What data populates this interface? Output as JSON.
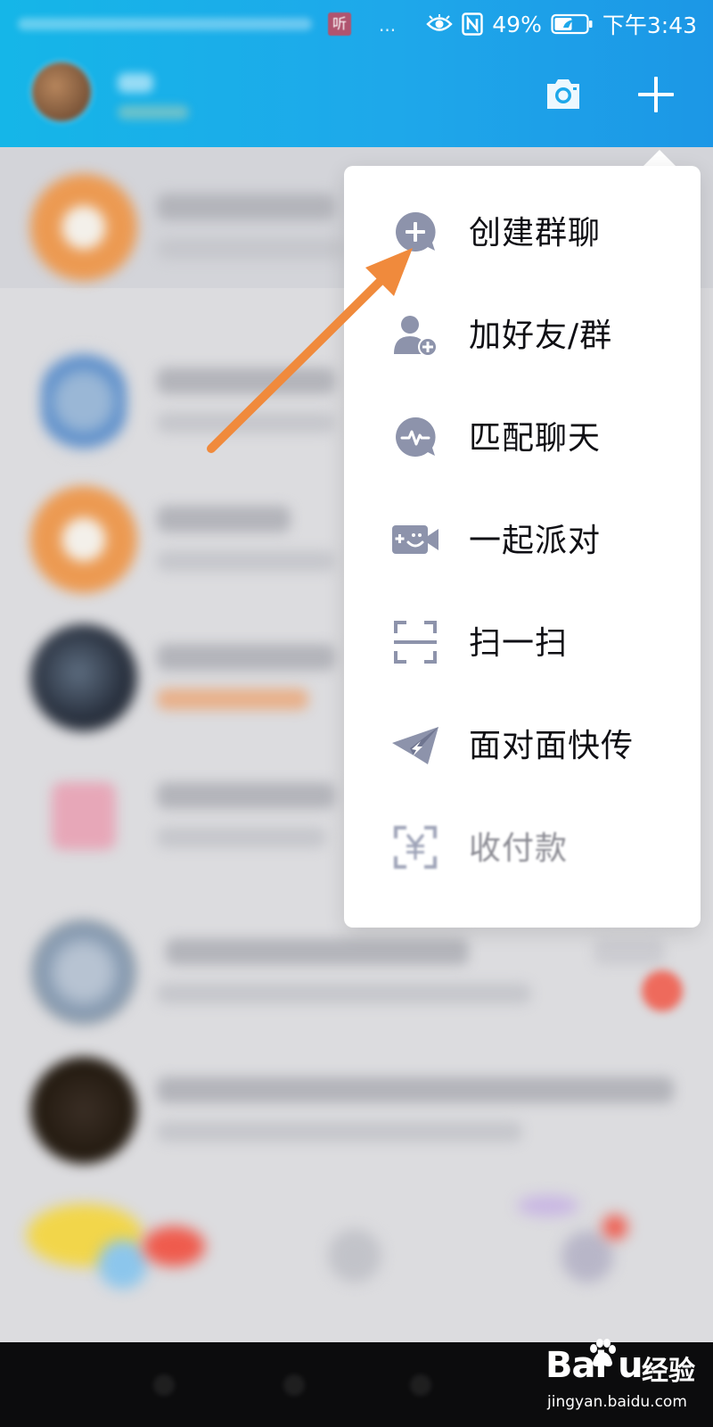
{
  "status_bar": {
    "ting_badge": "听",
    "more_dots": "···",
    "battery": "49%",
    "time": "下午3:43"
  },
  "colors": {
    "header_blue": "#1ea8ea",
    "menu_icon": "#8d93ab",
    "arrow_orange": "#f08a3c"
  },
  "header": {
    "camera_icon": "camera-icon",
    "plus_icon": "plus-icon"
  },
  "menu": {
    "items": [
      {
        "label": "创建群聊",
        "icon": "create-group-chat-icon"
      },
      {
        "label": "加好友/群",
        "icon": "add-friend-icon"
      },
      {
        "label": "匹配聊天",
        "icon": "match-chat-icon"
      },
      {
        "label": "一起派对",
        "icon": "party-icon"
      },
      {
        "label": "扫一扫",
        "icon": "scan-icon"
      },
      {
        "label": "面对面快传",
        "icon": "face-to-face-transfer-icon"
      },
      {
        "label": "收付款",
        "icon": "payment-icon"
      }
    ]
  },
  "watermark": {
    "logo": "Bai  u",
    "jingyan": "经验",
    "url": "jingyan.baidu.com"
  }
}
